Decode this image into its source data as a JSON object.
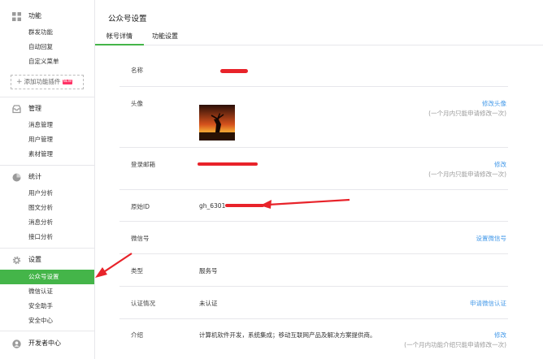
{
  "sidebar": {
    "sections": [
      {
        "title": "功能",
        "icon": "grid-icon",
        "items": [
          "群发功能",
          "自动回复",
          "自定义菜单"
        ]
      },
      {
        "title": "管理",
        "icon": "inbox-icon",
        "items": [
          "消息管理",
          "用户管理",
          "素材管理"
        ]
      },
      {
        "title": "统计",
        "icon": "pie-chart-icon",
        "items": [
          "用户分析",
          "图文分析",
          "消息分析",
          "接口分析"
        ]
      },
      {
        "title": "设置",
        "icon": "gear-icon",
        "items": [
          "公众号设置",
          "微信认证",
          "安全助手",
          "安全中心"
        ]
      },
      {
        "title": "开发者中心",
        "icon": "user-icon",
        "items": []
      }
    ],
    "plugin_button": "添加功能插件",
    "plugin_badge": "NEW",
    "active_item": "公众号设置"
  },
  "page": {
    "title": "公众号设置",
    "tabs": [
      "帐号详情",
      "功能设置"
    ],
    "active_tab": "帐号详情"
  },
  "rows": {
    "name": {
      "label": "名称"
    },
    "avatar": {
      "label": "头像",
      "action": "修改头像",
      "hint": "(一个月内只能申请修改一次)"
    },
    "email": {
      "label": "登录邮箱",
      "action": "修改",
      "hint": "(一个月内只能申请修改一次)"
    },
    "origin_id": {
      "label": "原始ID",
      "value": "gh_6301"
    },
    "wechat_id": {
      "label": "微信号",
      "action": "设置微信号"
    },
    "type": {
      "label": "类型",
      "value": "服务号"
    },
    "auth": {
      "label": "认证情况",
      "value": "未认证",
      "action": "申请微信认证"
    },
    "intro": {
      "label": "介绍",
      "value": "计算机软件开发，系统集成；移动互联网产品及解决方案提供商。",
      "action": "修改",
      "hint": "(一个月内功能介绍只能申请修改一次)"
    }
  },
  "colors": {
    "accent": "#44b549",
    "link": "#459ae9",
    "annotation": "#e8232a"
  }
}
